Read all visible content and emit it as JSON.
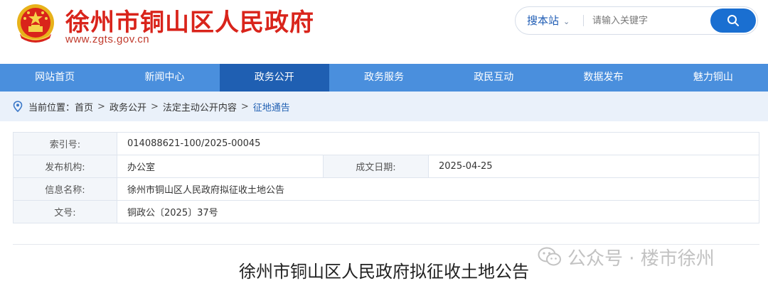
{
  "header": {
    "site_title": "徐州市铜山区人民政府",
    "site_url": "www.zgts.gov.cn",
    "emblem_icon": "national-emblem-icon"
  },
  "search": {
    "scope_label": "搜本站",
    "placeholder": "请输入关键字",
    "button_icon": "search-icon"
  },
  "nav": {
    "items": [
      {
        "label": "网站首页"
      },
      {
        "label": "新闻中心"
      },
      {
        "label": "政务公开"
      },
      {
        "label": "政务服务"
      },
      {
        "label": "政民互动"
      },
      {
        "label": "数据发布"
      },
      {
        "label": "魅力铜山"
      }
    ],
    "active_index": 2
  },
  "breadcrumb": {
    "prefix": "当前位置：",
    "items": [
      "首页",
      "政务公开",
      "法定主动公开内容",
      "征地通告"
    ],
    "separator": ">"
  },
  "info": {
    "index_label": "索引号:",
    "index_value": "014088621-100/2025-00045",
    "org_label": "发布机构:",
    "org_value": "办公室",
    "date_label": "成文日期:",
    "date_value": "2025-04-25",
    "name_label": "信息名称:",
    "name_value": "徐州市铜山区人民政府拟征收土地公告",
    "doc_label": "文号:",
    "doc_value": "铜政公〔2025〕37号"
  },
  "article": {
    "title": "徐州市铜山区人民政府拟征收土地公告"
  },
  "watermark": {
    "text": "公众号 · 楼市徐州",
    "icon": "wechat-icon"
  },
  "colors": {
    "brand_red": "#d9241b",
    "nav_blue": "#4a8fdd",
    "nav_active": "#1f5fb2",
    "search_button": "#1a6fd1",
    "breadcrumb_bg": "#eaf1fa"
  }
}
